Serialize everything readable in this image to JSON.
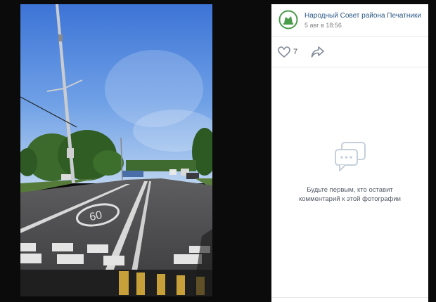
{
  "post": {
    "author": "Народный Совет района Печатники",
    "date": "5 авг в 18:56",
    "likes": "7"
  },
  "comments": {
    "empty_line1": "Будьте первым, кто оставит",
    "empty_line2": "комментарий к этой фотографии"
  },
  "icons": {
    "like": "heart-icon",
    "share": "share-icon",
    "comments": "comments-icon",
    "avatar": "group-logo"
  },
  "colors": {
    "link": "#2a5885",
    "muted": "#828282",
    "avatar_green": "#4a9b4a",
    "viewer_bg": "#0b0b0b"
  }
}
